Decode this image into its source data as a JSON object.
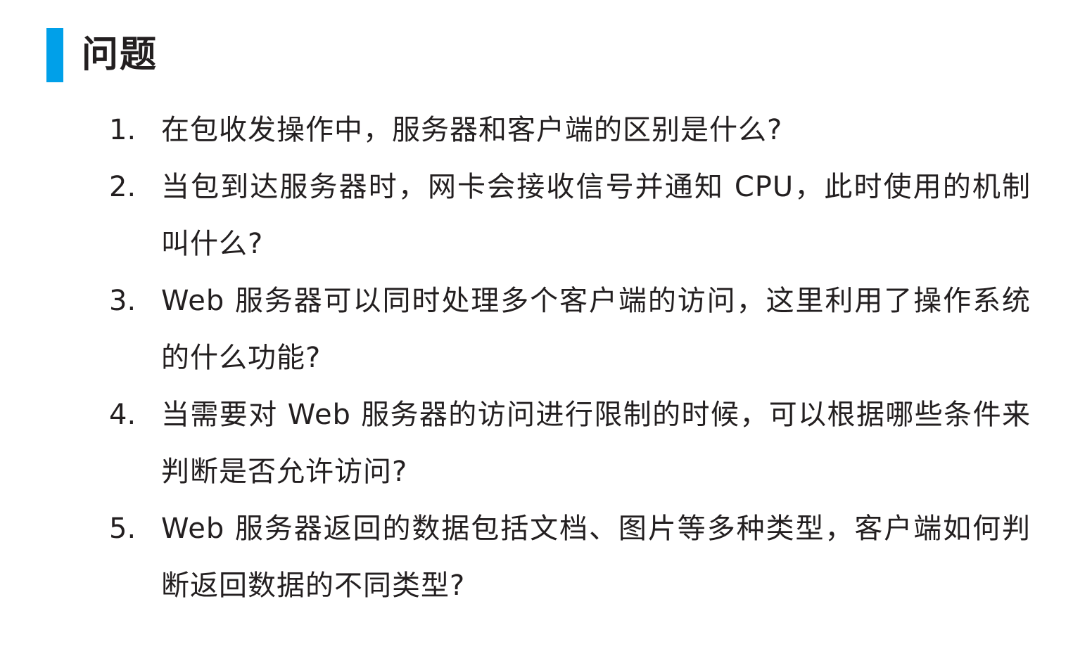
{
  "heading": {
    "title": "问题",
    "accent_color": "#00a0e9"
  },
  "questions": [
    {
      "number": "1.",
      "text": "在包收发操作中，服务器和客户端的区别是什么?"
    },
    {
      "number": "2.",
      "text": "当包到达服务器时，网卡会接收信号并通知 CPU，此时使用的机制叫什么?"
    },
    {
      "number": "3.",
      "text": "Web 服务器可以同时处理多个客户端的访问，这里利用了操作系统的什么功能?"
    },
    {
      "number": "4.",
      "text": "当需要对 Web 服务器的访问进行限制的时候，可以根据哪些条件来判断是否允许访问?"
    },
    {
      "number": "5.",
      "text": "Web 服务器返回的数据包括文档、图片等多种类型，客户端如何判断返回数据的不同类型?"
    }
  ]
}
